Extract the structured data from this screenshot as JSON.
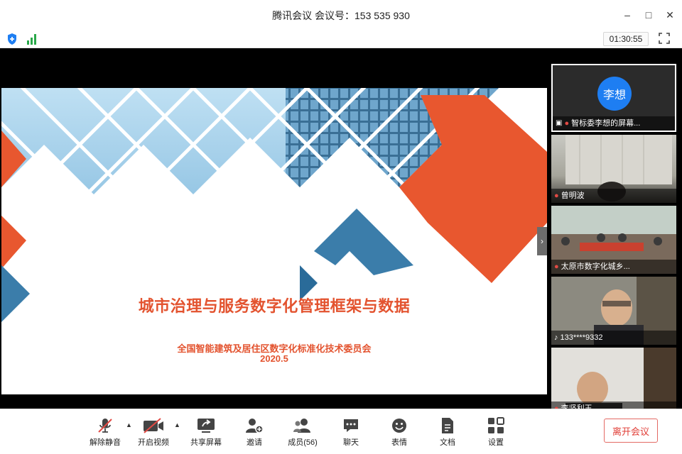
{
  "window": {
    "title": "腾讯会议 会议号：153 535 930",
    "controls": {
      "minimize": "–",
      "maximize": "□",
      "close": "✕"
    }
  },
  "status": {
    "security_icon": "shield-icon",
    "signal_icon": "signal-icon",
    "timer": "01:30:55",
    "fullscreen_icon": "fullscreen-icon"
  },
  "slide": {
    "title": "城市治理与服务数字化管理框架与数据",
    "org": "全国智能建筑及居住区数字化标准化技术委员会",
    "date": "2020.5",
    "accent_color": "#e3532f"
  },
  "expand_handle": "›",
  "participants": [
    {
      "avatar_text": "李想",
      "label": "智标委李想的屏幕...",
      "sharing": true,
      "muted": true
    },
    {
      "label": "曾明波",
      "muted": true
    },
    {
      "label": "太原市数字化城乡...",
      "muted": true
    },
    {
      "label": "133****9332",
      "muted": false
    },
    {
      "label": "李坚利王",
      "muted": true
    }
  ],
  "toolbar": {
    "mute": "解除静音",
    "video": "开启视频",
    "share": "共享屏幕",
    "invite": "邀请",
    "members": "成员(56)",
    "chat": "聊天",
    "reactions": "表情",
    "docs": "文档",
    "settings": "设置",
    "leave": "离开会议"
  }
}
